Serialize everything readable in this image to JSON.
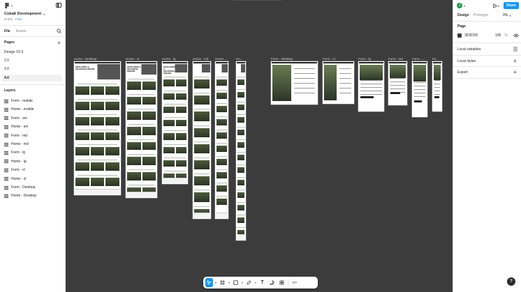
{
  "header": {
    "file_name": "Cobalt Development",
    "location": "Drafts",
    "plan": "Free",
    "menu_icon": "figma-logo-icon"
  },
  "left_tabs": {
    "file": "File",
    "assets": "Assets"
  },
  "pages": {
    "title": "Pages",
    "items": [
      "Design V1.0",
      "2.0",
      "3.0",
      "4.0"
    ],
    "selected": "4.0"
  },
  "layers": {
    "title": "Layers",
    "items": [
      "Form - mobile",
      "Home - mobile",
      "Form - sm",
      "Home - sm",
      "Form - md",
      "Home - md",
      "Form - lg",
      "Home - lg",
      "Form - xl",
      "Home - xl",
      "Form - Desktop",
      "Home - Desktop"
    ]
  },
  "right": {
    "avatar_letter": "J",
    "share_label": "Share",
    "tabs": {
      "design": "Design",
      "prototype": "Prototype"
    },
    "zoom": "9%",
    "page_section": {
      "title": "Page",
      "color_hex": "3D3D3D",
      "opacity": "100",
      "opacity_unit": "%"
    },
    "sections": [
      "Local variables",
      "Local styles",
      "Export"
    ]
  },
  "frames": [
    {
      "label": "Home - Desktop",
      "type": "home"
    },
    {
      "label": "Home - xl",
      "type": "home"
    },
    {
      "label": "Home - lg",
      "type": "home"
    },
    {
      "label": "Home - md",
      "type": "home"
    },
    {
      "label": "Home ...",
      "type": "home"
    },
    {
      "label": "Ho...",
      "type": "home"
    },
    {
      "label": "Form - Desktop",
      "type": "form"
    },
    {
      "label": "Form - xl",
      "type": "form"
    },
    {
      "label": "Form - lg",
      "type": "form"
    },
    {
      "label": "Form - md",
      "type": "form"
    },
    {
      "label": "Form - ...",
      "type": "form"
    },
    {
      "label": "Fo...",
      "type": "form"
    }
  ],
  "hero_text": "DEVELOPING & DELIVERING DREAMS",
  "help": "?",
  "colors": {
    "canvas": "#3c3c3c",
    "accent": "#0d99ff",
    "avatar": "#1e9e4a"
  }
}
